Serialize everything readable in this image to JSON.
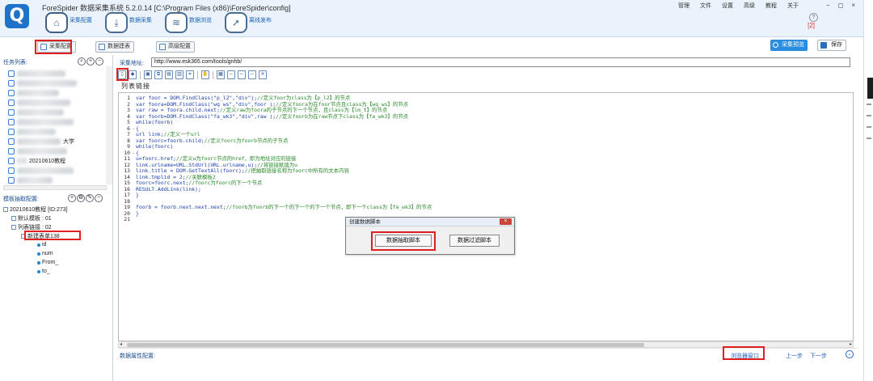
{
  "app": {
    "logo_glyph": "Q",
    "title": "ForeSpider 数据采集系统  5.2.0.14  [C:\\Program Files (x86)\\ForeSpider\\config]"
  },
  "topnav": [
    {
      "label": "采集配置",
      "icon": "home-icon",
      "active": true
    },
    {
      "label": "数据采集",
      "icon": "download-icon",
      "active": false
    },
    {
      "label": "数据浏览",
      "icon": "layers-icon",
      "active": false
    },
    {
      "label": "离线发布",
      "icon": "send-icon",
      "active": false
    }
  ],
  "window_menu": [
    "管理",
    "文件",
    "设置",
    "高级",
    "教程",
    "关于"
  ],
  "window_controls": [
    "−",
    "◻",
    "×"
  ],
  "help_glyph": "?",
  "notification_count": "[2]",
  "subbar": {
    "config_btn": "采集配置",
    "table_btn": "数据建表",
    "advanced_btn": "高级配置",
    "preview_btn": "采集预览",
    "save_btn": "保存"
  },
  "task_panel": {
    "header": "任务列表:",
    "visible_items": [
      "大学",
      "20210610教程"
    ]
  },
  "template_panel": {
    "header": "模板抽取配置:",
    "root": "20210610教程 [ID:273]",
    "default_template": "默认模板 : 01",
    "list_link": "列表链接 : 02",
    "new_table": "新建表单138",
    "fields": [
      "id",
      "num",
      "From_",
      "to_"
    ]
  },
  "main": {
    "url_label": "采集地址:",
    "url_value": "http://www.esk365.com/tools/gnhb/",
    "editor_tab": "列表链接"
  },
  "code_lines": [
    {
      "n": "1",
      "fold": "",
      "text": "var foor = DOM.FindClass(\"p_l2\",\"div\");//定义foor为class为【p_l2】的节点"
    },
    {
      "n": "2",
      "fold": "",
      "text": "var foora=DOM.FindClass(\"wq ws\",\"div\",foor );//定义foora为在foor节点且class为【wq ws】的节点"
    },
    {
      "n": "3",
      "fold": "",
      "text": "var raw = foora.child.next;//定义raw为foora的子节点的下一个节点，且class为【lm_t】的节点"
    },
    {
      "n": "4",
      "fold": "",
      "text": "var foorb=DOM.FindClass(\"fa_wk3\",\"div\",raw );//定义foorb为在raw节点下class为【fa_wk3】的节点"
    },
    {
      "n": "5",
      "fold": "",
      "text": "while(foorb)"
    },
    {
      "n": "6",
      "fold": "-",
      "text": "{"
    },
    {
      "n": "7",
      "fold": "",
      "text": "   url link;//定义一个url"
    },
    {
      "n": "8",
      "fold": "",
      "text": "   var foorc=foorb.child;//定义foorc为foorb节点的子节点"
    },
    {
      "n": "9",
      "fold": "",
      "text": "   while(foorc)"
    },
    {
      "n": "10",
      "fold": "-",
      "text": "   {"
    },
    {
      "n": "11",
      "fold": "",
      "text": "      u=foorc.href;//定义u为foorc节点的href，即为地址对应的链接"
    },
    {
      "n": "12",
      "fold": "",
      "text": "      link.urlname=URL.StdUrl(URL.urlname,u);//将链接赋值为u"
    },
    {
      "n": "13",
      "fold": "",
      "text": "      link.title = DOM.GetTextAll(foorc);//把抽取链接名称为foorc中所有的文本内容"
    },
    {
      "n": "14",
      "fold": "",
      "text": "      link.tmplid = 2;//关联模板2"
    },
    {
      "n": "15",
      "fold": "",
      "text": "      foorc=foorc.next;//foorc为foorc的下一个节点"
    },
    {
      "n": "16",
      "fold": "",
      "text": "      RESULT.AddLink(link);"
    },
    {
      "n": "17",
      "fold": "",
      "text": "   }"
    },
    {
      "n": "18",
      "fold": "",
      "text": ""
    },
    {
      "n": "19",
      "fold": "",
      "text": "   foorb = foorb.next.next.next;//foorb为foorb的下一个的下一个的下一个节点，即下一个class为【fa_wk3】的节点"
    },
    {
      "n": "20",
      "fold": "",
      "text": "}"
    },
    {
      "n": "21",
      "fold": "",
      "text": ""
    }
  ],
  "dialog": {
    "title": "创建数据脚本",
    "close": "×",
    "extract_btn": "数据抽取脚本",
    "filter_btn": "数据过滤脚本"
  },
  "bottombar": {
    "label": "数据属性配置:",
    "browser_link": "浏览器窗口",
    "prev": "上一步",
    "next": "下一步",
    "collapse_glyph": "⌄"
  },
  "highlight_color": "#e02020"
}
